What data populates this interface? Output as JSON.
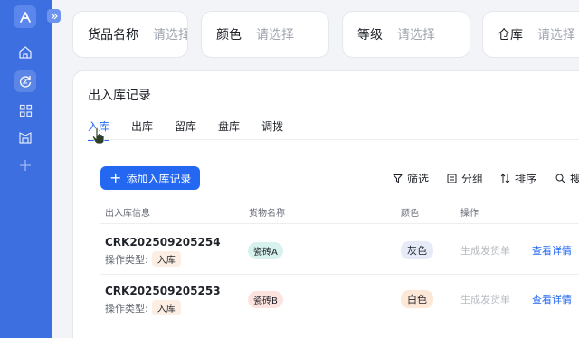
{
  "sidebar": {
    "logo_icon": "app-logo-icon",
    "collapse_icon": "double-chevron-right-icon",
    "nav_icons": [
      "home-icon",
      "refresh-icon",
      "grid-icon",
      "warehouse-icon",
      "plus-icon"
    ]
  },
  "filters": [
    {
      "label": "货品名称",
      "placeholder": "请选择"
    },
    {
      "label": "颜色",
      "placeholder": "请选择"
    },
    {
      "label": "等级",
      "placeholder": "请选择"
    },
    {
      "label": "仓库",
      "placeholder": "请选择"
    }
  ],
  "main": {
    "title": "出入库记录",
    "tabs": [
      "入库",
      "出库",
      "留库",
      "盘库",
      "调拨"
    ],
    "active_tab": "入库",
    "add_button": "添加入库记录",
    "tools": {
      "filter": "筛选",
      "group": "分组",
      "sort": "排序",
      "search": "搜"
    },
    "columns": [
      "出入库信息",
      "货物名称",
      "颜色",
      "操作"
    ],
    "op_type_label": "操作类型:",
    "rows": [
      {
        "code": "CRK202509205254",
        "op_type": "入库",
        "goods": "瓷砖A",
        "color": "灰色",
        "generate": "生成发货单",
        "detail": "查看详情"
      },
      {
        "code": "CRK202509205253",
        "op_type": "入库",
        "goods": "瓷砖B",
        "color": "白色",
        "generate": "生成发货单",
        "detail": "查看详情"
      }
    ]
  },
  "colors": {
    "sidebar": "#3d6fe0",
    "accent": "#2468f2",
    "tag_in": "#fdeee3",
    "goods_a": "#d6f1ee",
    "goods_b": "#fde3e0",
    "gray_tag": "#e6ebf7",
    "white_tag": "#fde7d6"
  }
}
